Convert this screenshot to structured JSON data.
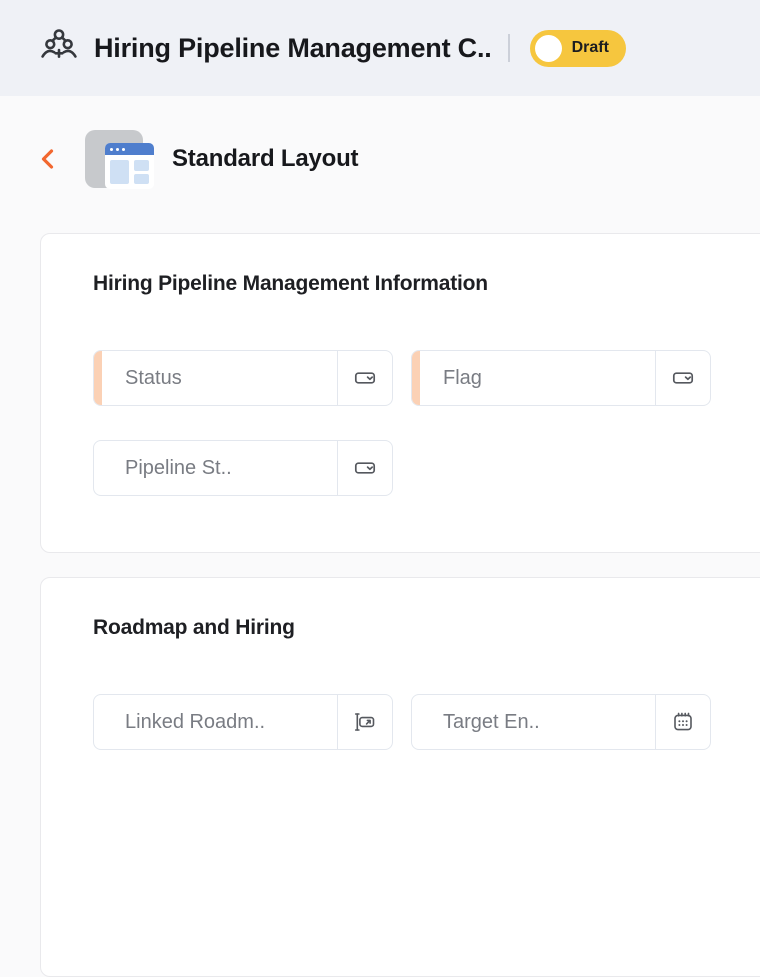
{
  "header": {
    "title": "Hiring Pipeline Management C..",
    "module_icon": "team-hierarchy-icon",
    "status": {
      "label": "Draft",
      "state": "on"
    }
  },
  "layout_bar": {
    "back_icon": "chevron-left-icon",
    "layout_icon": "standard-layout-icon",
    "title": "Standard Layout"
  },
  "sections": [
    {
      "title": "Hiring Pipeline Management Information",
      "fields": [
        {
          "label": "Status",
          "required": true,
          "icon": "picklist-icon"
        },
        {
          "label": "Flag",
          "required": true,
          "icon": "picklist-icon"
        },
        {
          "label": "Pipeline St..",
          "required": false,
          "icon": "picklist-icon"
        }
      ]
    },
    {
      "title": "Roadmap and Hiring",
      "fields": [
        {
          "label": "Linked Roadm..",
          "required": false,
          "icon": "lookup-icon"
        },
        {
          "label": "Target En..",
          "required": false,
          "icon": "calendar-icon"
        }
      ]
    }
  ],
  "colors": {
    "header_bg": "#eff1f6",
    "page_bg": "#fafafb",
    "draft_yellow": "#f6c63e",
    "back_orange": "#f2672f",
    "required_marker": "#fbd1b5",
    "icon_gray": "#55585e"
  }
}
